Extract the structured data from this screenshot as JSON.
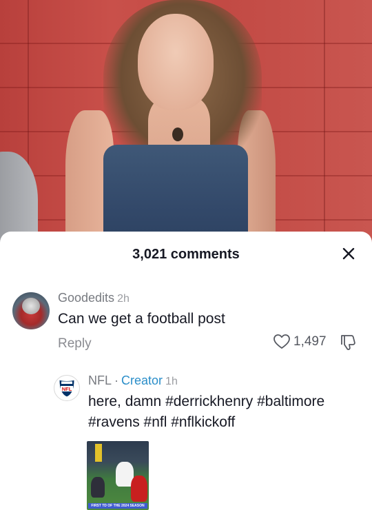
{
  "sheet": {
    "title": "3,021 comments"
  },
  "comment": {
    "username": "Goodedits",
    "time": "2h",
    "text": "Can we get a football post",
    "reply_label": "Reply",
    "likes": "1,497"
  },
  "reply": {
    "username": "NFL",
    "separator": "·",
    "badge": "Creator",
    "time": "1h",
    "text": "here, damn #derrickhenry #baltimore #ravens #nfl #nflkickoff",
    "avatar_label": "NFL",
    "thumbnail_caption": "FIRST TD OF THE 2024 SEASON"
  },
  "icons": {
    "close": "close-icon",
    "like": "heart-icon",
    "dislike": "thumbs-down-icon",
    "nfl_logo": "nfl-shield-icon"
  },
  "colors": {
    "creator": "#2a8ec9",
    "nfl_red": "#d50a0a",
    "nfl_blue": "#013369"
  }
}
